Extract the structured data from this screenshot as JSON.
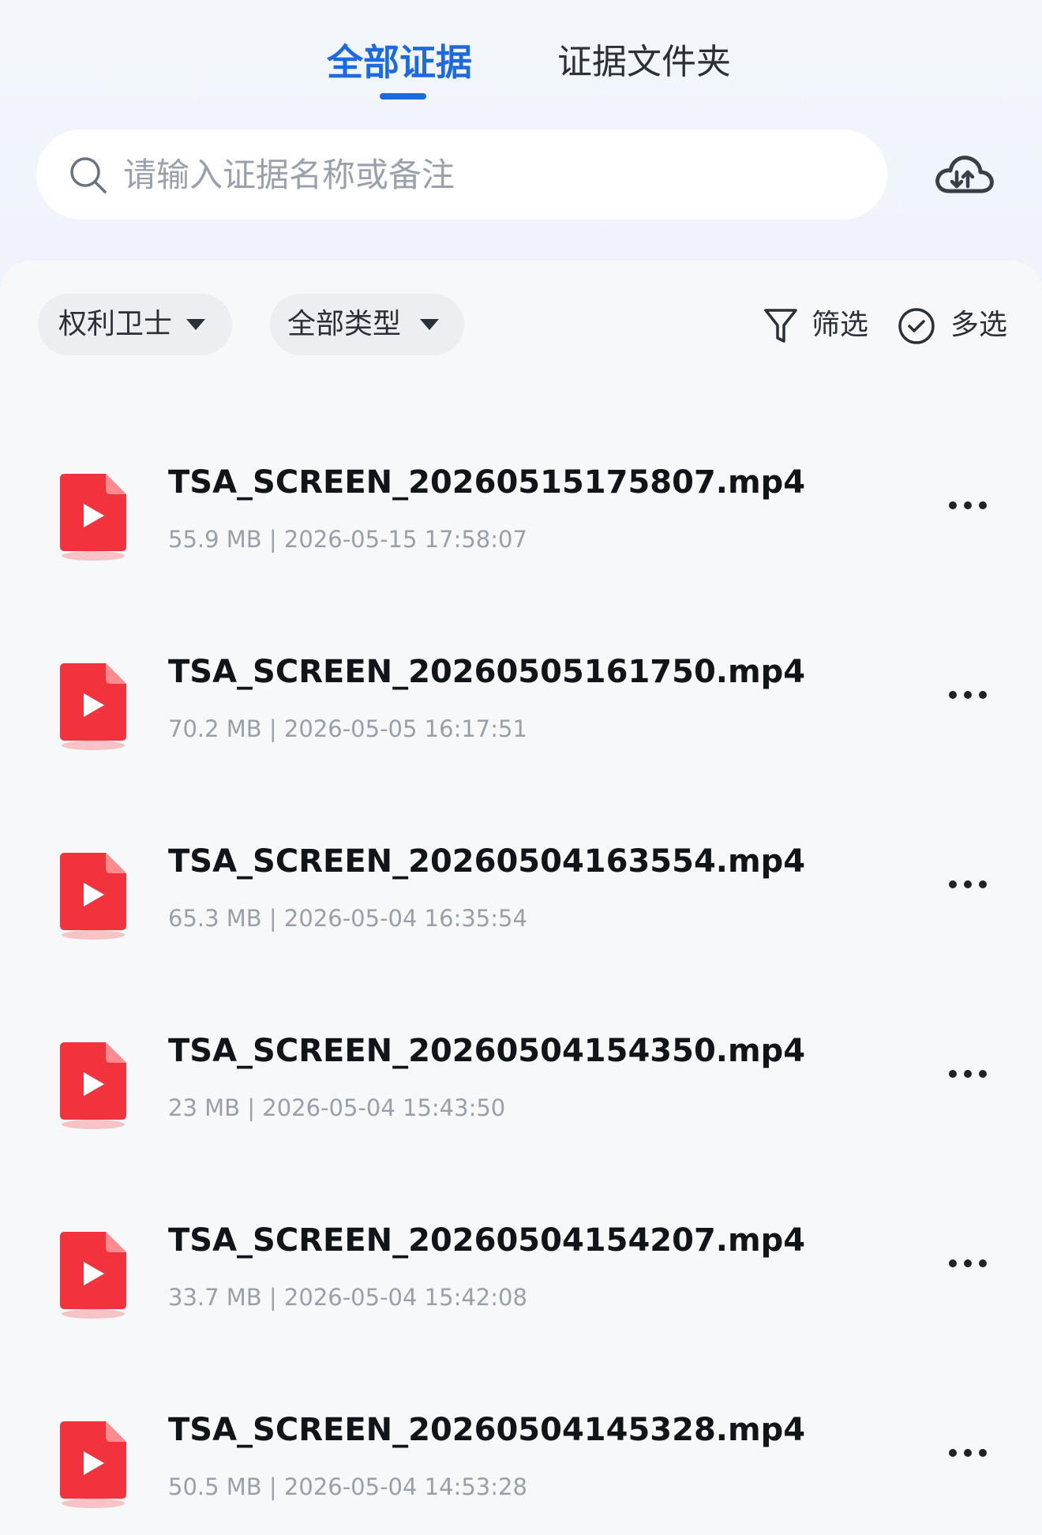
{
  "tabs": [
    {
      "label": "全部证据",
      "active": true
    },
    {
      "label": "证据文件夹",
      "active": false
    }
  ],
  "search": {
    "placeholder": "请输入证据名称或备注"
  },
  "filters": {
    "rights_label": "权利卫士",
    "type_label": "全部类型",
    "filter_label": "筛选",
    "multi_label": "多选"
  },
  "colors": {
    "accent": "#1d6ae0",
    "file_red": "#f0333c"
  },
  "icons": {
    "search": "search-icon",
    "upload": "cloud-upload-icon",
    "filter": "funnel-icon",
    "multi": "check-circle-icon",
    "file": "video-file-icon",
    "more": "more-icon"
  },
  "files": [
    {
      "name": "TSA_SCREEN_20260515175807.mp4",
      "meta": "55.9 MB | 2026-05-15 17:58:07"
    },
    {
      "name": "TSA_SCREEN_20260505161750.mp4",
      "meta": "70.2 MB | 2026-05-05 16:17:51"
    },
    {
      "name": "TSA_SCREEN_20260504163554.mp4",
      "meta": "65.3 MB | 2026-05-04 16:35:54"
    },
    {
      "name": "TSA_SCREEN_20260504154350.mp4",
      "meta": "23 MB | 2026-05-04 15:43:50"
    },
    {
      "name": "TSA_SCREEN_20260504154207.mp4",
      "meta": "33.7 MB | 2026-05-04 15:42:08"
    },
    {
      "name": "TSA_SCREEN_20260504145328.mp4",
      "meta": "50.5 MB | 2026-05-04 14:53:28"
    }
  ]
}
